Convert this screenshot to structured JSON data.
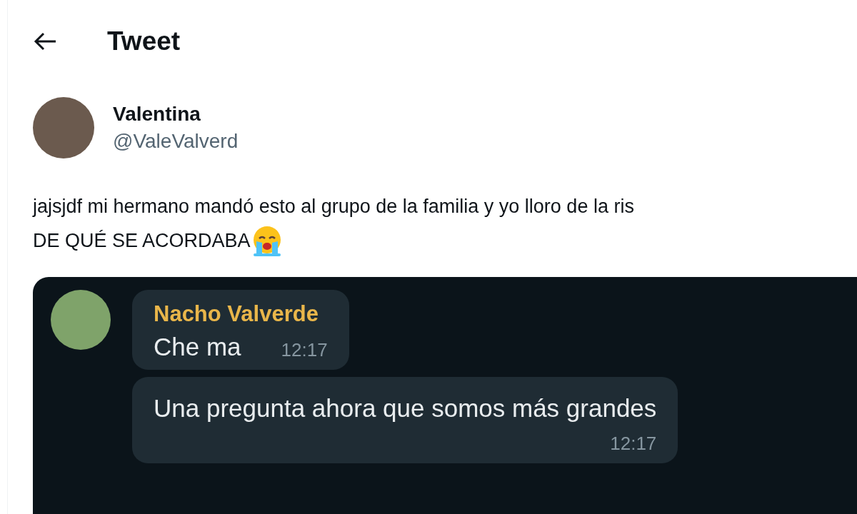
{
  "header": {
    "title": "Tweet"
  },
  "author": {
    "name": "Valentina",
    "handle": "@ValeValverd"
  },
  "tweet_text": [
    "jajsjdf mi hermano mandó esto al grupo de la familia y yo lloro de la ris",
    "DE QUÉ SE ACORDABA"
  ],
  "chat": {
    "sender": "Nacho Valverde",
    "messages": [
      {
        "text": "Che ma",
        "time": "12:17",
        "show_sender": true
      },
      {
        "text": "Una pregunta ahora que somos más grandes",
        "time": "12:17",
        "show_sender": false
      }
    ]
  }
}
